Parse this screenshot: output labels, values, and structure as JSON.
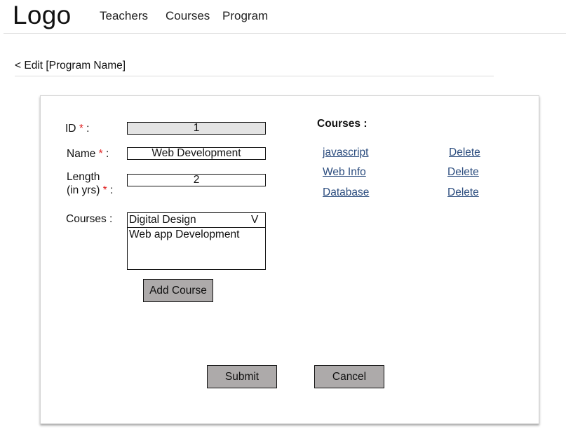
{
  "header": {
    "logo": "Logo",
    "nav": [
      "Teachers",
      "Courses",
      "Program"
    ]
  },
  "breadcrumb": "< Edit [Program Name]",
  "form": {
    "id_label": "ID",
    "id_value": "1",
    "name_label": "Name",
    "name_value": "Web Development",
    "length_label_line1": "Length",
    "length_label_line2": "(in yrs)",
    "length_value": "2",
    "required_marker": "*",
    "label_suffix": ":",
    "courses_label": "Courses :",
    "courses_select": {
      "selected": "Digital Design",
      "caret": "V",
      "options": [
        "Web app Development"
      ]
    },
    "add_course_label": "Add Course",
    "submit_label": "Submit",
    "cancel_label": "Cancel"
  },
  "assigned_courses": {
    "title": "Courses :",
    "items": [
      {
        "name": "javascript ",
        "action": "Delete"
      },
      {
        "name": "Web Info ",
        "action": "Delete"
      },
      {
        "name": "Database ",
        "action": "Delete"
      }
    ]
  },
  "colors": {
    "required": "#e02020",
    "link": "#2b4c7e",
    "button": "#adaaaa",
    "readonly_field": "#e3e3e3"
  }
}
